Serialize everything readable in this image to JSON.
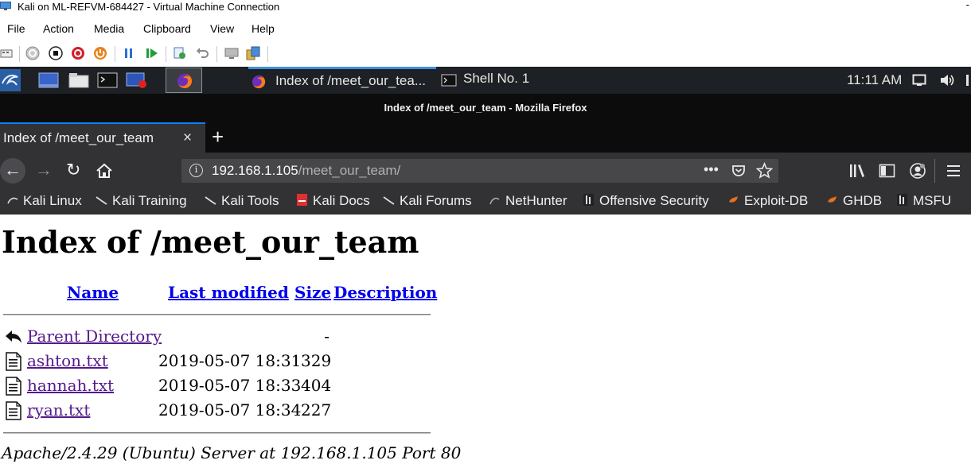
{
  "vm": {
    "title": "Kali on ML-REFVM-684427 - Virtual Machine Connection",
    "minimize": "-",
    "menu": [
      "File",
      "Action",
      "Media",
      "Clipboard",
      "View",
      "Help"
    ]
  },
  "taskbar": {
    "windows": [
      {
        "label": "Index of /meet_our_tea...",
        "icon": "firefox-icon",
        "active": true
      },
      {
        "label": "Shell No. 1",
        "icon": "terminal-icon",
        "active": false
      }
    ],
    "clock": "11:11 AM"
  },
  "firefox": {
    "window_title": "Index of /meet_our_team - Mozilla Firefox",
    "tab": {
      "title": "Index of /meet_our_team",
      "close": "×"
    },
    "new_tab": "+",
    "url": {
      "host": "192.168.1.105",
      "path": "/meet_our_team/"
    },
    "bookmarks": [
      {
        "label": "Kali Linux",
        "icon": "kali-dragon-icon"
      },
      {
        "label": "Kali Training",
        "icon": "kali-dragon-icon"
      },
      {
        "label": "Kali Tools",
        "icon": "kali-dragon-icon"
      },
      {
        "label": "Kali Docs",
        "icon": "kali-docs-icon"
      },
      {
        "label": "Kali Forums",
        "icon": "kali-dragon-icon"
      },
      {
        "label": "NetHunter",
        "icon": "nethunter-icon"
      },
      {
        "label": "Offensive Security",
        "icon": "offsec-icon"
      },
      {
        "label": "Exploit-DB",
        "icon": "exploitdb-icon"
      },
      {
        "label": "GHDB",
        "icon": "exploitdb-icon"
      },
      {
        "label": "MSFU",
        "icon": "offsec-icon"
      }
    ]
  },
  "page": {
    "heading": "Index of /meet_our_team",
    "columns": {
      "name": "Name",
      "modified": "Last modified",
      "size": "Size",
      "description": "Description"
    },
    "rows": [
      {
        "name": "Parent Directory",
        "modified": "",
        "size": "-",
        "icon": "back-arrow-icon"
      },
      {
        "name": "ashton.txt",
        "modified": "2019-05-07 18:31",
        "size": "329",
        "icon": "text-file-icon"
      },
      {
        "name": "hannah.txt",
        "modified": "2019-05-07 18:33",
        "size": "404",
        "icon": "text-file-icon"
      },
      {
        "name": "ryan.txt",
        "modified": "2019-05-07 18:34",
        "size": "227",
        "icon": "text-file-icon"
      }
    ],
    "footer": "Apache/2.4.29 (Ubuntu) Server at 192.168.1.105 Port 80"
  },
  "colors": {
    "taskbar_bg": "#1d2024",
    "firefox_chrome": "#323234",
    "firefox_titlebar": "#0c0c0d",
    "link_visited": "#551a8b",
    "link": "#0000ee",
    "accent": "#0a84ff"
  }
}
